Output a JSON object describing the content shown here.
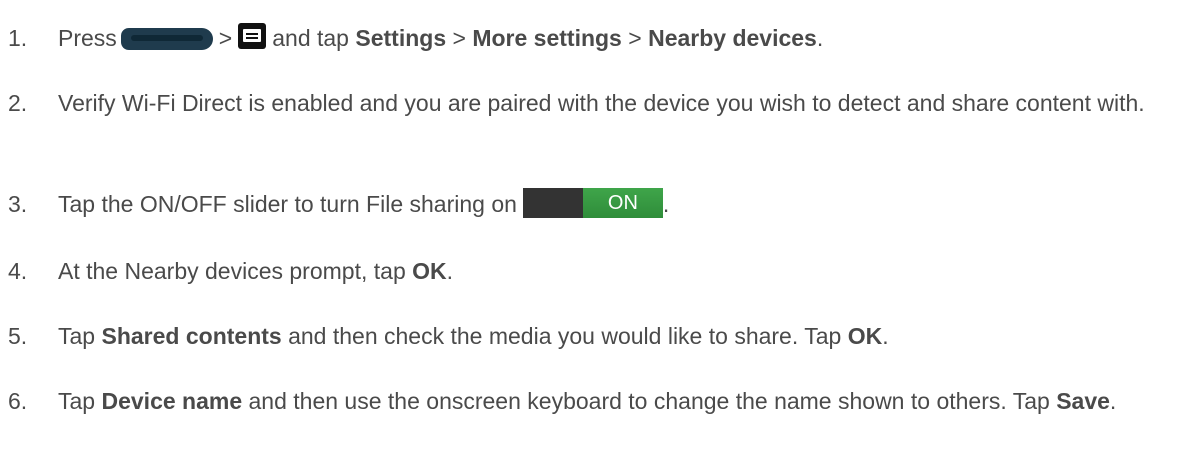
{
  "steps": [
    {
      "number": "1.",
      "t1": "Press",
      "icon1": "home-key-icon",
      "t2": ">",
      "icon2": "menu-key-icon",
      "t3": "and tap",
      "b1": "Settings",
      "t4": ">",
      "b2": "More settings",
      "t5": ">",
      "b3": "Nearby devices",
      "t6": "."
    },
    {
      "number": "2.",
      "text": "Verify Wi-Fi Direct is enabled and you are paired with the device you wish to detect and share content with."
    },
    {
      "number": "3.",
      "t1": "Tap the ON/OFF slider to turn File sharing on",
      "toggle_label": "ON",
      "t2": "."
    },
    {
      "number": "4.",
      "t1": "At the Nearby devices prompt, tap",
      "b1": "OK",
      "t2": "."
    },
    {
      "number": "5.",
      "t1": "Tap",
      "b1": "Shared contents",
      "t2": "and then check the media you would like to share. Tap",
      "b2": "OK",
      "t3": "."
    },
    {
      "number": "6.",
      "t1": "Tap",
      "b1": "Device name",
      "t2": "and then use the onscreen keyboard to change the name shown to others. Tap",
      "b2": "Save",
      "t3": "."
    }
  ],
  "colors": {
    "text": "#4a4a4a",
    "toggle_on": "#3fa54a",
    "home_key": "#1f3b4d"
  }
}
